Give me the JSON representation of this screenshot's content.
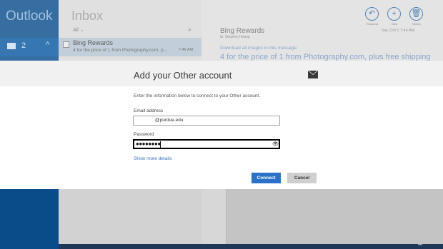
{
  "nav": {
    "app_title": "Outlook",
    "unread_count": "2",
    "expand_glyph": "^"
  },
  "list": {
    "title": "Inbox",
    "filter": "All ⌄",
    "search_glyph": "⌕",
    "messages": [
      {
        "sender": "Bing Rewards",
        "preview": "4 for the price of 1 from Photography.com, p...",
        "time": "7:46 AM"
      }
    ]
  },
  "reading": {
    "sender": "Bing Rewards",
    "to": "to: Stephen Hoang",
    "date": "Sat, Oct 2 7:46 AM",
    "download_link": "Download all images in this message",
    "subject": "4 for the price of 1 from Photography.com, plus free shipping",
    "commands": [
      {
        "glyph": "↶",
        "label": "Respond"
      },
      {
        "glyph": "+",
        "label": "New"
      },
      {
        "glyph": "🗑",
        "label": "Delete"
      }
    ]
  },
  "dialog": {
    "title": "Add your Other account",
    "instructions": "Enter the information below to connect to your Other account.",
    "email_label": "Email address",
    "email_value": "@purdue.edu",
    "password_label": "Password",
    "password_value": "●●●●●●●●",
    "reveal_glyph": "👁",
    "more_link": "Show more details",
    "connect_label": "Connect",
    "cancel_label": "Cancel"
  },
  "bottom": {
    "dots": "•••"
  },
  "colors": {
    "nav_bg": "#0a4f8e",
    "accent": "#2a72c9",
    "dialog_bg": "#ffffff"
  },
  "icons": [
    "mail-icon",
    "chevron-up-icon",
    "search-icon",
    "checkbox-icon",
    "reply-icon",
    "plus-icon",
    "trash-icon",
    "envelope-icon",
    "eye-icon",
    "more-dots-icon"
  ]
}
